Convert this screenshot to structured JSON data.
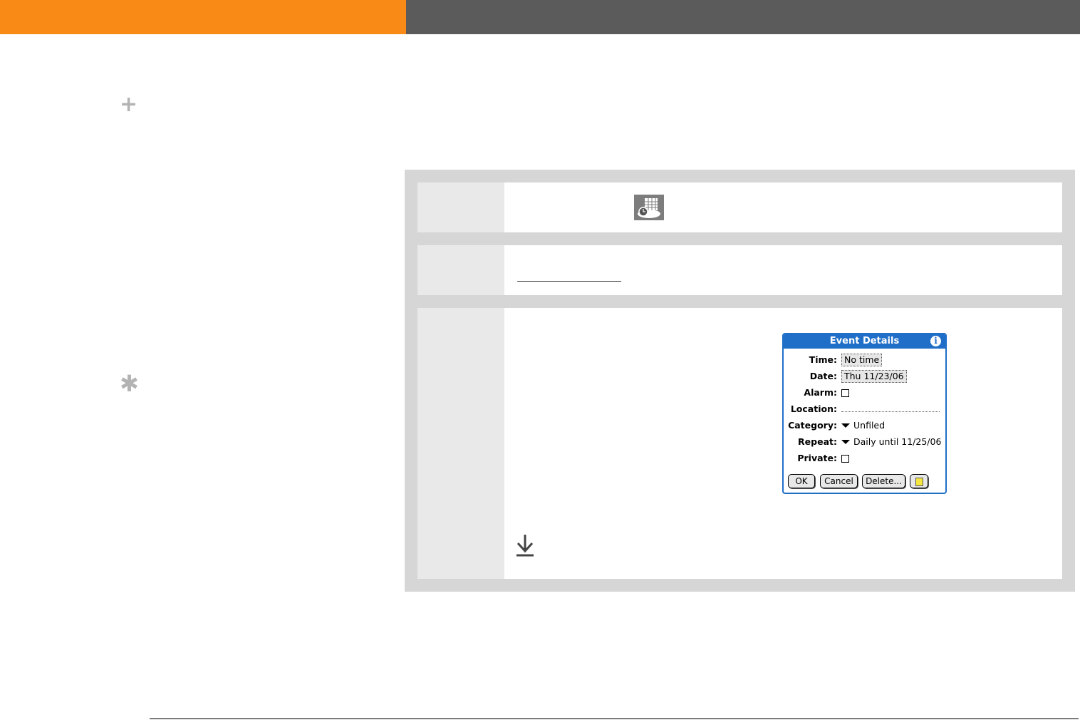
{
  "colors": {
    "header_accent": "#f98a16",
    "header_bar": "#5b5b5b",
    "panel_bg": "#d6d6d6",
    "number_cell_bg": "#e9e9e9",
    "dialog_blue": "#1f6fc9",
    "sidebar_glyph": "#b3b3b3"
  },
  "sidebar": {
    "plus_glyph": "+",
    "star_glyph": "✱"
  },
  "steps": {
    "step1": {
      "icon": "calendar-app-icon"
    },
    "step2": {
      "icon": "none"
    },
    "step3": {
      "icon": "download-arrow-icon"
    }
  },
  "dialog": {
    "title": "Event Details",
    "info_glyph": "i",
    "fields": {
      "time_label": "Time:",
      "time_value": "No time",
      "date_label": "Date:",
      "date_value": "Thu 11/23/06",
      "alarm_label": "Alarm:",
      "location_label": "Location:",
      "category_label": "Category:",
      "category_value": "Unfiled",
      "repeat_label": "Repeat:",
      "repeat_value": "Daily until 11/25/06",
      "private_label": "Private:"
    },
    "buttons": {
      "ok": "OK",
      "cancel": "Cancel",
      "delete": "Delete..."
    }
  }
}
